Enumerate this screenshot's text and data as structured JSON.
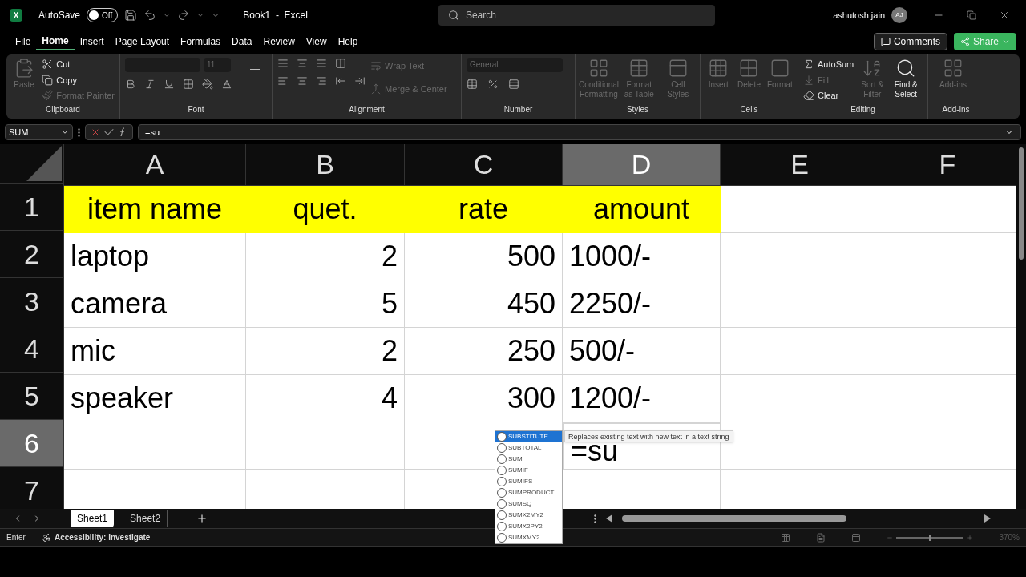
{
  "title_bar": {
    "app_icon": "X",
    "autosave_label": "AutoSave",
    "autosave_toggle": {
      "label": "Off",
      "on": false
    },
    "document_title": "Book1  -  Excel",
    "search_placeholder": "Search",
    "user_name": "ashutosh jain",
    "avatar_initials": "AJ"
  },
  "menu_tabs": [
    {
      "label": "File",
      "selected": false
    },
    {
      "label": "Home",
      "selected": true
    },
    {
      "label": "Insert",
      "selected": false
    },
    {
      "label": "Page Layout",
      "selected": false
    },
    {
      "label": "Formulas",
      "selected": false
    },
    {
      "label": "Data",
      "selected": false
    },
    {
      "label": "Review",
      "selected": false
    },
    {
      "label": "View",
      "selected": false
    },
    {
      "label": "Help",
      "selected": false
    }
  ],
  "comments_button": "Comments",
  "share_button": "Share",
  "ribbon": {
    "clipboard": {
      "group_label": "Clipboard",
      "paste": {
        "label": "Paste",
        "disabled": true
      },
      "cut": {
        "label": "Cut",
        "disabled": false
      },
      "copy": {
        "label": "Copy",
        "disabled": false
      },
      "format_painter": {
        "label": "Format Painter",
        "disabled": true
      }
    },
    "font": {
      "group_label": "Font",
      "font_size": "11"
    },
    "alignment": {
      "group_label": "Alignment",
      "wrap_text": {
        "label": "Wrap Text",
        "disabled": true
      },
      "merge_center": {
        "label": "Merge & Center",
        "disabled": true
      }
    },
    "number": {
      "group_label": "Number",
      "format": "General"
    },
    "styles": {
      "group_label": "Styles",
      "items": [
        {
          "label": "Conditional Formatting",
          "disabled": true
        },
        {
          "label": "Format as Table",
          "disabled": true
        },
        {
          "label": "Cell Styles",
          "disabled": true
        }
      ]
    },
    "cells": {
      "group_label": "Cells",
      "items": [
        {
          "label": "Insert",
          "disabled": true
        },
        {
          "label": "Delete",
          "disabled": true
        },
        {
          "label": "Format",
          "disabled": true
        }
      ]
    },
    "editing": {
      "group_label": "Editing",
      "autosum": {
        "label": "AutoSum",
        "disabled": false
      },
      "fill": {
        "label": "Fill",
        "disabled": true
      },
      "clear": {
        "label": "Clear",
        "disabled": false
      },
      "sort_filter": {
        "label": "Sort & Filter",
        "disabled": true
      },
      "find_select": {
        "label": "Find & Select",
        "disabled": false
      }
    },
    "addins": {
      "group_label": "Add-ins",
      "items": [
        {
          "label": "Add-ins",
          "disabled": true
        }
      ]
    }
  },
  "formula_bar": {
    "name_box": "SUM",
    "formula": "=su"
  },
  "sheet": {
    "columns": [
      {
        "label": "A",
        "selected": false
      },
      {
        "label": "B",
        "selected": false
      },
      {
        "label": "C",
        "selected": false
      },
      {
        "label": "D",
        "selected": true
      },
      {
        "label": "E",
        "selected": false
      },
      {
        "label": "F",
        "selected": false
      }
    ],
    "rows": [
      {
        "number": "1",
        "selected": false,
        "cells": [
          {
            "kind": "header",
            "text": "item name"
          },
          {
            "kind": "header",
            "text": "quet."
          },
          {
            "kind": "header",
            "text": "rate"
          },
          {
            "kind": "header",
            "text": "amount"
          }
        ]
      },
      {
        "number": "2",
        "selected": false,
        "cells": [
          {
            "kind": "text",
            "text": "laptop"
          },
          {
            "kind": "number",
            "text": "2"
          },
          {
            "kind": "number",
            "text": "500"
          },
          {
            "kind": "text",
            "text": "1000/-"
          }
        ]
      },
      {
        "number": "3",
        "selected": false,
        "cells": [
          {
            "kind": "text",
            "text": "camera"
          },
          {
            "kind": "number",
            "text": "5"
          },
          {
            "kind": "number",
            "text": "450"
          },
          {
            "kind": "text",
            "text": "2250/-"
          }
        ]
      },
      {
        "number": "4",
        "selected": false,
        "cells": [
          {
            "kind": "text",
            "text": "mic"
          },
          {
            "kind": "number",
            "text": "2"
          },
          {
            "kind": "number",
            "text": "250"
          },
          {
            "kind": "text",
            "text": "500/-"
          }
        ]
      },
      {
        "number": "5",
        "selected": false,
        "cells": [
          {
            "kind": "text",
            "text": "speaker"
          },
          {
            "kind": "number",
            "text": "4"
          },
          {
            "kind": "number",
            "text": "300"
          },
          {
            "kind": "text",
            "text": "1200/-"
          }
        ]
      },
      {
        "number": "6",
        "selected": true,
        "cells": [
          {
            "kind": "blank"
          },
          {
            "kind": "blank"
          },
          {
            "kind": "blank"
          },
          {
            "kind": "editing",
            "text": "=su"
          }
        ]
      },
      {
        "number": "7",
        "selected": false,
        "cells": []
      }
    ]
  },
  "autocomplete": {
    "tooltip": "Replaces existing text with new text in a text string",
    "items": [
      {
        "label": "SUBSTITUTE",
        "selected": true
      },
      {
        "label": "SUBTOTAL",
        "selected": false
      },
      {
        "label": "SUM",
        "selected": false
      },
      {
        "label": "SUMIF",
        "selected": false
      },
      {
        "label": "SUMIFS",
        "selected": false
      },
      {
        "label": "SUMPRODUCT",
        "selected": false
      },
      {
        "label": "SUMSQ",
        "selected": false
      },
      {
        "label": "SUMX2MY2",
        "selected": false
      },
      {
        "label": "SUMX2PY2",
        "selected": false
      },
      {
        "label": "SUMXMY2",
        "selected": false
      }
    ]
  },
  "sheet_tabs": [
    {
      "label": "Sheet1",
      "selected": true
    },
    {
      "label": "Sheet2",
      "selected": false
    }
  ],
  "status_bar": {
    "mode": "Enter",
    "accessibility": "Accessibility: Investigate",
    "zoom_slider": {
      "level": 0.48
    },
    "zoom": "370%"
  }
}
